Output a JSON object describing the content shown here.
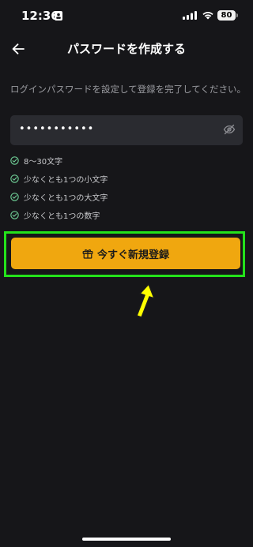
{
  "status_bar": {
    "time": "12:36",
    "battery": "80"
  },
  "header": {
    "title": "パスワードを作成する"
  },
  "description": "ログインパスワードを設定して登録を完了してください。",
  "password": {
    "value": "•••••••••••"
  },
  "requirements": [
    {
      "label": "8〜30文字",
      "status": "check-circle-icon"
    },
    {
      "label": "少なくとも1つの小文字",
      "status": "check-circle-icon"
    },
    {
      "label": "少なくとも1つの大文字",
      "status": "check-circle-icon"
    },
    {
      "label": "少なくとも1つの数字",
      "status": "check-circle-icon"
    }
  ],
  "register_button": {
    "label": "今すぐ新規登録",
    "icon": "gift-icon"
  },
  "colors": {
    "background": "#161619",
    "accent": "#f0a70f",
    "highlight": "#24e21b",
    "check": "#6fcf97",
    "arrow": "#ffff00"
  }
}
